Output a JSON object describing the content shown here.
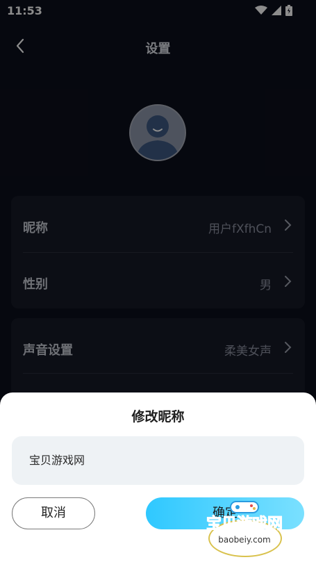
{
  "status_bar": {
    "time": "11:53",
    "icons": [
      "wifi-icon",
      "signal-icon",
      "battery-icon"
    ]
  },
  "header": {
    "title": "设置",
    "back_icon": "back-chevron-icon"
  },
  "profile": {
    "avatar_icon": "avatar-icon"
  },
  "settings": {
    "card1": [
      {
        "label": "昵称",
        "value": "用户fXfhCn"
      },
      {
        "label": "性别",
        "value": "男"
      }
    ],
    "card2": [
      {
        "label": "声音设置",
        "value": "柔美女声"
      }
    ]
  },
  "dialog": {
    "title": "修改昵称",
    "input_value": "宝贝游戏网",
    "cancel_label": "取消",
    "confirm_label": "确定"
  },
  "watermark": {
    "text": "宝贝游戏网",
    "url": "baobeiy.com"
  },
  "colors": {
    "accent": "#2fc8ff",
    "background": "#0c0f1c",
    "card": "#171a27"
  }
}
